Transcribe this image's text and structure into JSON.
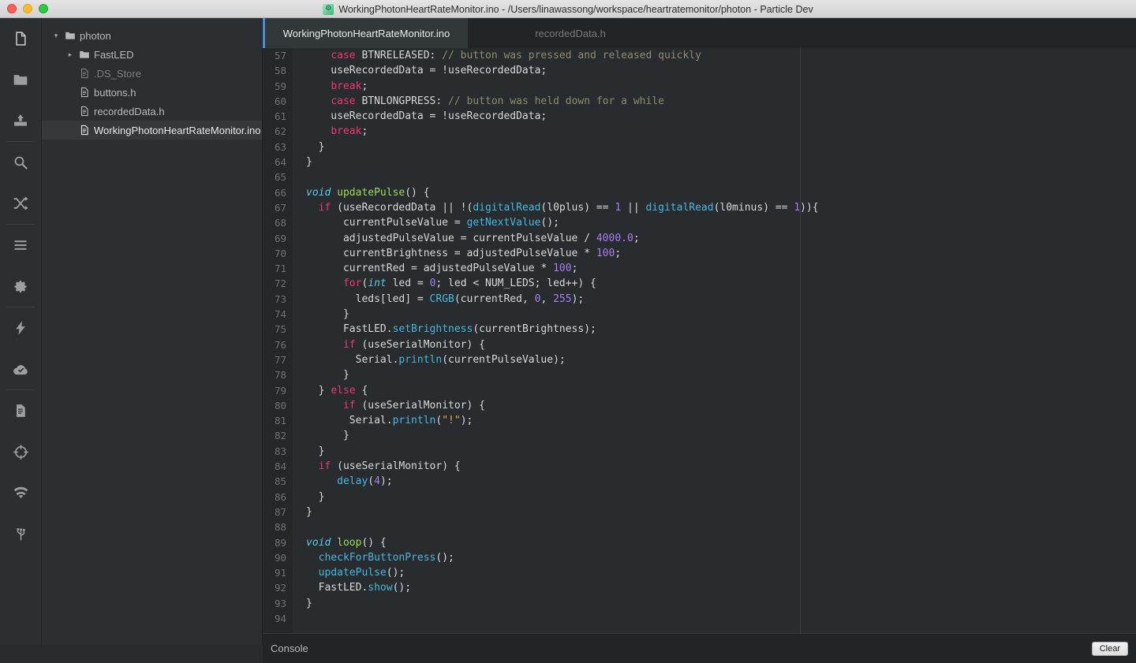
{
  "window": {
    "title": "WorkingPhotonHeartRateMonitor.ino - /Users/linawassong/workspace/heartratemonitor/photon - Particle Dev",
    "title_icon": "particle-app-icon",
    "traffic_lights": [
      "close-button",
      "minimize-button",
      "zoom-button"
    ]
  },
  "rail": {
    "items": [
      {
        "name": "file-icon",
        "active": true
      },
      {
        "name": "folder-icon",
        "active": false
      },
      {
        "name": "download-icon",
        "active": false
      },
      {
        "name": "search-icon",
        "active": false
      },
      {
        "name": "shuffle-icon",
        "active": false
      },
      {
        "name": "list-icon",
        "active": false
      },
      {
        "name": "gear-icon",
        "active": false
      },
      {
        "name": "lightning-icon",
        "active": false
      },
      {
        "name": "cloud-check-icon",
        "active": false
      },
      {
        "name": "document-icon",
        "active": false
      },
      {
        "name": "target-icon",
        "active": false
      },
      {
        "name": "wifi-icon",
        "active": false
      },
      {
        "name": "usb-icon",
        "active": false
      }
    ]
  },
  "tree": {
    "items": [
      {
        "label": "photon",
        "type": "folder",
        "depth": 0,
        "arrow": "▾",
        "selected": false,
        "dim": false
      },
      {
        "label": "FastLED",
        "type": "folder",
        "depth": 1,
        "arrow": "▸",
        "selected": false,
        "dim": false
      },
      {
        "label": ".DS_Store",
        "type": "file",
        "depth": 1,
        "arrow": "",
        "selected": false,
        "dim": true
      },
      {
        "label": "buttons.h",
        "type": "file",
        "depth": 1,
        "arrow": "",
        "selected": false,
        "dim": false
      },
      {
        "label": "recordedData.h",
        "type": "file",
        "depth": 1,
        "arrow": "",
        "selected": false,
        "dim": false
      },
      {
        "label": "WorkingPhotonHeartRateMonitor.ino",
        "type": "file",
        "depth": 1,
        "arrow": "",
        "selected": true,
        "dim": false
      }
    ]
  },
  "tabs": [
    {
      "label": "WorkingPhotonHeartRateMonitor.ino",
      "active": true
    },
    {
      "label": "recordedData.h",
      "active": false
    }
  ],
  "console": {
    "label": "Console",
    "clear_label": "Clear"
  },
  "accent_colors": {
    "tab_active_border": "#4a90d9",
    "keyword": "#f0376f",
    "type": "#5dc8e8",
    "function_def": "#9fd957",
    "function_call": "#46b7e0",
    "number": "#a87ef0",
    "string": "#e6a94a",
    "comment": "#8e8b6e",
    "plain": "#d6d9da"
  },
  "code": {
    "first_line": 57,
    "last_line": 94,
    "lines": [
      {
        "n": 57,
        "t": [
          {
            "c": "pln",
            "s": "    "
          },
          {
            "c": "kw",
            "s": "case"
          },
          {
            "c": "pln",
            "s": " BTNRELEASED: "
          },
          {
            "c": "cmt",
            "s": "// button was pressed and released quickly"
          }
        ]
      },
      {
        "n": 58,
        "t": [
          {
            "c": "pln",
            "s": "    useRecordedData = !useRecordedData;"
          }
        ]
      },
      {
        "n": 59,
        "t": [
          {
            "c": "pln",
            "s": "    "
          },
          {
            "c": "kw",
            "s": "break"
          },
          {
            "c": "pln",
            "s": ";"
          }
        ]
      },
      {
        "n": 60,
        "t": [
          {
            "c": "pln",
            "s": "    "
          },
          {
            "c": "kw",
            "s": "case"
          },
          {
            "c": "pln",
            "s": " BTNLONGPRESS: "
          },
          {
            "c": "cmt",
            "s": "// button was held down for a while"
          }
        ]
      },
      {
        "n": 61,
        "t": [
          {
            "c": "pln",
            "s": "    useRecordedData = !useRecordedData;"
          }
        ]
      },
      {
        "n": 62,
        "t": [
          {
            "c": "pln",
            "s": "    "
          },
          {
            "c": "kw",
            "s": "break"
          },
          {
            "c": "pln",
            "s": ";"
          }
        ]
      },
      {
        "n": 63,
        "t": [
          {
            "c": "pln",
            "s": "  }"
          }
        ]
      },
      {
        "n": 64,
        "t": [
          {
            "c": "pln",
            "s": "}"
          }
        ]
      },
      {
        "n": 65,
        "t": []
      },
      {
        "n": 66,
        "t": [
          {
            "c": "type",
            "s": "void"
          },
          {
            "c": "pln",
            "s": " "
          },
          {
            "c": "fn",
            "s": "updatePulse"
          },
          {
            "c": "pln",
            "s": "() {"
          }
        ]
      },
      {
        "n": 67,
        "t": [
          {
            "c": "pln",
            "s": "  "
          },
          {
            "c": "kw",
            "s": "if"
          },
          {
            "c": "pln",
            "s": " (useRecordedData || !("
          },
          {
            "c": "call",
            "s": "digitalRead"
          },
          {
            "c": "pln",
            "s": "(l0plus) == "
          },
          {
            "c": "num2",
            "s": "1"
          },
          {
            "c": "pln",
            "s": " || "
          },
          {
            "c": "call",
            "s": "digitalRead"
          },
          {
            "c": "pln",
            "s": "(l0minus) == "
          },
          {
            "c": "num2",
            "s": "1"
          },
          {
            "c": "pln",
            "s": ")){"
          }
        ]
      },
      {
        "n": 68,
        "t": [
          {
            "c": "pln",
            "s": "      currentPulseValue = "
          },
          {
            "c": "call",
            "s": "getNextValue"
          },
          {
            "c": "pln",
            "s": "();"
          }
        ]
      },
      {
        "n": 69,
        "t": [
          {
            "c": "pln",
            "s": "      adjustedPulseValue = currentPulseValue / "
          },
          {
            "c": "num2",
            "s": "4000.0"
          },
          {
            "c": "pln",
            "s": ";"
          }
        ]
      },
      {
        "n": 70,
        "t": [
          {
            "c": "pln",
            "s": "      currentBrightness = adjustedPulseValue * "
          },
          {
            "c": "num2",
            "s": "100"
          },
          {
            "c": "pln",
            "s": ";"
          }
        ]
      },
      {
        "n": 71,
        "t": [
          {
            "c": "pln",
            "s": "      currentRed = adjustedPulseValue * "
          },
          {
            "c": "num2",
            "s": "100"
          },
          {
            "c": "pln",
            "s": ";"
          }
        ]
      },
      {
        "n": 72,
        "t": [
          {
            "c": "pln",
            "s": "      "
          },
          {
            "c": "kw",
            "s": "for"
          },
          {
            "c": "pln",
            "s": "("
          },
          {
            "c": "type",
            "s": "int"
          },
          {
            "c": "pln",
            "s": " led = "
          },
          {
            "c": "num2",
            "s": "0"
          },
          {
            "c": "pln",
            "s": "; led < NUM_LEDS; led++) {"
          }
        ]
      },
      {
        "n": 73,
        "t": [
          {
            "c": "pln",
            "s": "        leds[led] = "
          },
          {
            "c": "call",
            "s": "CRGB"
          },
          {
            "c": "pln",
            "s": "(currentRed, "
          },
          {
            "c": "num2",
            "s": "0"
          },
          {
            "c": "pln",
            "s": ", "
          },
          {
            "c": "num2",
            "s": "255"
          },
          {
            "c": "pln",
            "s": ");"
          }
        ]
      },
      {
        "n": 74,
        "t": [
          {
            "c": "pln",
            "s": "      }"
          }
        ]
      },
      {
        "n": 75,
        "t": [
          {
            "c": "pln",
            "s": "      FastLED."
          },
          {
            "c": "call",
            "s": "setBrightness"
          },
          {
            "c": "pln",
            "s": "(currentBrightness);"
          }
        ]
      },
      {
        "n": 76,
        "t": [
          {
            "c": "pln",
            "s": "      "
          },
          {
            "c": "kw",
            "s": "if"
          },
          {
            "c": "pln",
            "s": " (useSerialMonitor) {"
          }
        ]
      },
      {
        "n": 77,
        "t": [
          {
            "c": "pln",
            "s": "        Serial."
          },
          {
            "c": "call",
            "s": "println"
          },
          {
            "c": "pln",
            "s": "(currentPulseValue);"
          }
        ]
      },
      {
        "n": 78,
        "t": [
          {
            "c": "pln",
            "s": "      }"
          }
        ]
      },
      {
        "n": 79,
        "t": [
          {
            "c": "pln",
            "s": "  } "
          },
          {
            "c": "kw",
            "s": "else"
          },
          {
            "c": "pln",
            "s": " {"
          }
        ]
      },
      {
        "n": 80,
        "t": [
          {
            "c": "pln",
            "s": "      "
          },
          {
            "c": "kw",
            "s": "if"
          },
          {
            "c": "pln",
            "s": " (useSerialMonitor) {"
          }
        ]
      },
      {
        "n": 81,
        "t": [
          {
            "c": "pln",
            "s": "       Serial."
          },
          {
            "c": "call",
            "s": "println"
          },
          {
            "c": "pln",
            "s": "("
          },
          {
            "c": "str",
            "s": "\"!\""
          },
          {
            "c": "pln",
            "s": ");"
          }
        ]
      },
      {
        "n": 82,
        "t": [
          {
            "c": "pln",
            "s": "      }"
          }
        ]
      },
      {
        "n": 83,
        "t": [
          {
            "c": "pln",
            "s": "  }"
          }
        ]
      },
      {
        "n": 84,
        "t": [
          {
            "c": "pln",
            "s": "  "
          },
          {
            "c": "kw",
            "s": "if"
          },
          {
            "c": "pln",
            "s": " (useSerialMonitor) {"
          }
        ]
      },
      {
        "n": 85,
        "t": [
          {
            "c": "pln",
            "s": "     "
          },
          {
            "c": "call",
            "s": "delay"
          },
          {
            "c": "pln",
            "s": "("
          },
          {
            "c": "num2",
            "s": "4"
          },
          {
            "c": "pln",
            "s": ");"
          }
        ]
      },
      {
        "n": 86,
        "t": [
          {
            "c": "pln",
            "s": "  }"
          }
        ]
      },
      {
        "n": 87,
        "t": [
          {
            "c": "pln",
            "s": "}"
          }
        ]
      },
      {
        "n": 88,
        "t": []
      },
      {
        "n": 89,
        "t": [
          {
            "c": "type",
            "s": "void"
          },
          {
            "c": "pln",
            "s": " "
          },
          {
            "c": "fn",
            "s": "loop"
          },
          {
            "c": "pln",
            "s": "() {"
          }
        ]
      },
      {
        "n": 90,
        "t": [
          {
            "c": "pln",
            "s": "  "
          },
          {
            "c": "call",
            "s": "checkForButtonPress"
          },
          {
            "c": "pln",
            "s": "();"
          }
        ]
      },
      {
        "n": 91,
        "t": [
          {
            "c": "pln",
            "s": "  "
          },
          {
            "c": "call",
            "s": "updatePulse"
          },
          {
            "c": "pln",
            "s": "();"
          }
        ]
      },
      {
        "n": 92,
        "t": [
          {
            "c": "pln",
            "s": "  FastLED."
          },
          {
            "c": "call",
            "s": "show"
          },
          {
            "c": "pln",
            "s": "();"
          }
        ]
      },
      {
        "n": 93,
        "t": [
          {
            "c": "pln",
            "s": "}"
          }
        ]
      },
      {
        "n": 94,
        "t": []
      }
    ]
  }
}
